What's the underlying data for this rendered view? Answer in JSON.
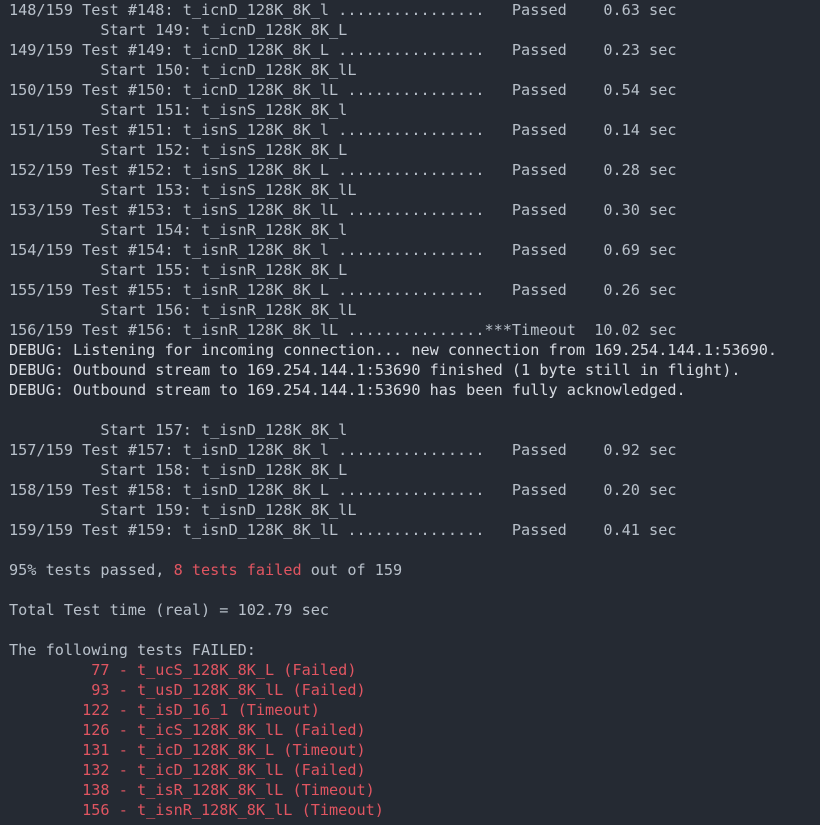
{
  "terminal": {
    "title": "ctest-output",
    "colors": {
      "background": "#252a33",
      "foreground": "#b8c0ca",
      "debug_foreground": "#d8dce3",
      "failure_red": "#e05561"
    },
    "summary": {
      "percent_passed": "95%",
      "failed_count": "8",
      "total_tests": "159",
      "total_time_sec": "102.79",
      "summary_prefix": "95% tests passed, ",
      "summary_failed_segment": "8 tests failed",
      "summary_suffix": " out of 159",
      "total_time_line": "Total Test time (real) = 102.79 sec",
      "failed_header": "The following tests FAILED:"
    },
    "lines": [
      {
        "kind": "test",
        "text": "148/159 Test #148: t_icnD_128K_8K_l ................   Passed    0.63 sec"
      },
      {
        "kind": "start",
        "text": "          Start 149: t_icnD_128K_8K_L"
      },
      {
        "kind": "test",
        "text": "149/159 Test #149: t_icnD_128K_8K_L ................   Passed    0.23 sec"
      },
      {
        "kind": "start",
        "text": "          Start 150: t_icnD_128K_8K_lL"
      },
      {
        "kind": "test",
        "text": "150/159 Test #150: t_icnD_128K_8K_lL ...............   Passed    0.54 sec"
      },
      {
        "kind": "start",
        "text": "          Start 151: t_isnS_128K_8K_l"
      },
      {
        "kind": "test",
        "text": "151/159 Test #151: t_isnS_128K_8K_l ................   Passed    0.14 sec"
      },
      {
        "kind": "start",
        "text": "          Start 152: t_isnS_128K_8K_L"
      },
      {
        "kind": "test",
        "text": "152/159 Test #152: t_isnS_128K_8K_L ................   Passed    0.28 sec"
      },
      {
        "kind": "start",
        "text": "          Start 153: t_isnS_128K_8K_lL"
      },
      {
        "kind": "test",
        "text": "153/159 Test #153: t_isnS_128K_8K_lL ...............   Passed    0.30 sec"
      },
      {
        "kind": "start",
        "text": "          Start 154: t_isnR_128K_8K_l"
      },
      {
        "kind": "test",
        "text": "154/159 Test #154: t_isnR_128K_8K_l ................   Passed    0.69 sec"
      },
      {
        "kind": "start",
        "text": "          Start 155: t_isnR_128K_8K_L"
      },
      {
        "kind": "test",
        "text": "155/159 Test #155: t_isnR_128K_8K_L ................   Passed    0.26 sec"
      },
      {
        "kind": "start",
        "text": "          Start 156: t_isnR_128K_8K_lL"
      },
      {
        "kind": "timeout",
        "text": "156/159 Test #156: t_isnR_128K_8K_lL ...............***Timeout  10.02 sec"
      },
      {
        "kind": "debug",
        "text": "DEBUG: Listening for incoming connection... new connection from 169.254.144.1:53690."
      },
      {
        "kind": "debug",
        "text": "DEBUG: Outbound stream to 169.254.144.1:53690 finished (1 byte still in flight)."
      },
      {
        "kind": "debug",
        "text": "DEBUG: Outbound stream to 169.254.144.1:53690 has been fully acknowledged."
      },
      {
        "kind": "blank",
        "text": " "
      },
      {
        "kind": "start",
        "text": "          Start 157: t_isnD_128K_8K_l"
      },
      {
        "kind": "test",
        "text": "157/159 Test #157: t_isnD_128K_8K_l ................   Passed    0.92 sec"
      },
      {
        "kind": "start",
        "text": "          Start 158: t_isnD_128K_8K_L"
      },
      {
        "kind": "test",
        "text": "158/159 Test #158: t_isnD_128K_8K_L ................   Passed    0.20 sec"
      },
      {
        "kind": "start",
        "text": "          Start 159: t_isnD_128K_8K_lL"
      },
      {
        "kind": "test",
        "text": "159/159 Test #159: t_isnD_128K_8K_lL ...............   Passed    0.41 sec"
      },
      {
        "kind": "blank",
        "text": " "
      }
    ],
    "failed_tests": [
      {
        "id": "77",
        "name": "t_ucS_128K_8K_L",
        "status": "(Failed)",
        "text": "         77 - t_ucS_128K_8K_L (Failed)"
      },
      {
        "id": "93",
        "name": "t_usD_128K_8K_lL",
        "status": "(Failed)",
        "text": "         93 - t_usD_128K_8K_lL (Failed)"
      },
      {
        "id": "122",
        "name": "t_isD_16_1",
        "status": "(Timeout)",
        "text": "        122 - t_isD_16_1 (Timeout)"
      },
      {
        "id": "126",
        "name": "t_icS_128K_8K_lL",
        "status": "(Failed)",
        "text": "        126 - t_icS_128K_8K_lL (Failed)"
      },
      {
        "id": "131",
        "name": "t_icD_128K_8K_L",
        "status": "(Timeout)",
        "text": "        131 - t_icD_128K_8K_L (Timeout)"
      },
      {
        "id": "132",
        "name": "t_icD_128K_8K_lL",
        "status": "(Failed)",
        "text": "        132 - t_icD_128K_8K_lL (Failed)"
      },
      {
        "id": "138",
        "name": "t_isR_128K_8K_lL",
        "status": "(Timeout)",
        "text": "        138 - t_isR_128K_8K_lL (Timeout)"
      },
      {
        "id": "156",
        "name": "t_isnR_128K_8K_lL",
        "status": "(Timeout)",
        "text": "        156 - t_isnR_128K_8K_lL (Timeout)"
      }
    ]
  }
}
